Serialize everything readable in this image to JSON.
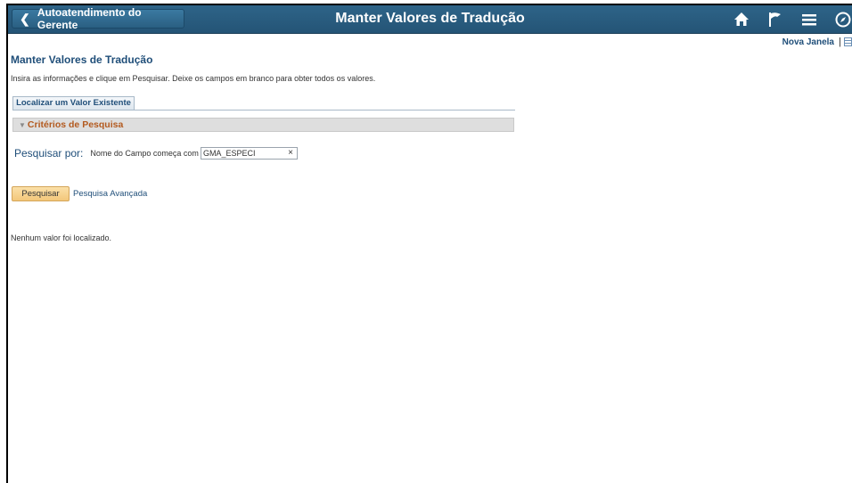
{
  "header": {
    "back_label": "Autoatendimento do Gerente",
    "title": "Manter Valores de Tradução",
    "icons": [
      "home-icon",
      "flag-icon",
      "menu-icon",
      "navbar-compass-icon"
    ]
  },
  "toolbar": {
    "new_window_label": "Nova Janela",
    "separator": "|"
  },
  "page": {
    "heading": "Manter Valores de Tradução",
    "instructions": "Insira as informações e clique em Pesquisar. Deixe os campos em branco para obter todos os valores."
  },
  "tabs": [
    {
      "label": "Localizar um Valor Existente",
      "active": true
    }
  ],
  "criteria": {
    "section_label": "Critérios de Pesquisa",
    "search_by_label": "Pesquisar por:",
    "field_label": "Nome do Campo começa com",
    "field_value": "GMA_ESPECI",
    "clear_symbol": "×"
  },
  "actions": {
    "search_label": "Pesquisar",
    "advanced_label": "Pesquisa Avançada"
  },
  "results": {
    "message": "Nenhum valor foi localizado."
  },
  "colors": {
    "header_bg": "#2a5f82",
    "link": "#1f4e79",
    "section_label": "#b35a1f",
    "primary_button": "#f3c77a"
  }
}
